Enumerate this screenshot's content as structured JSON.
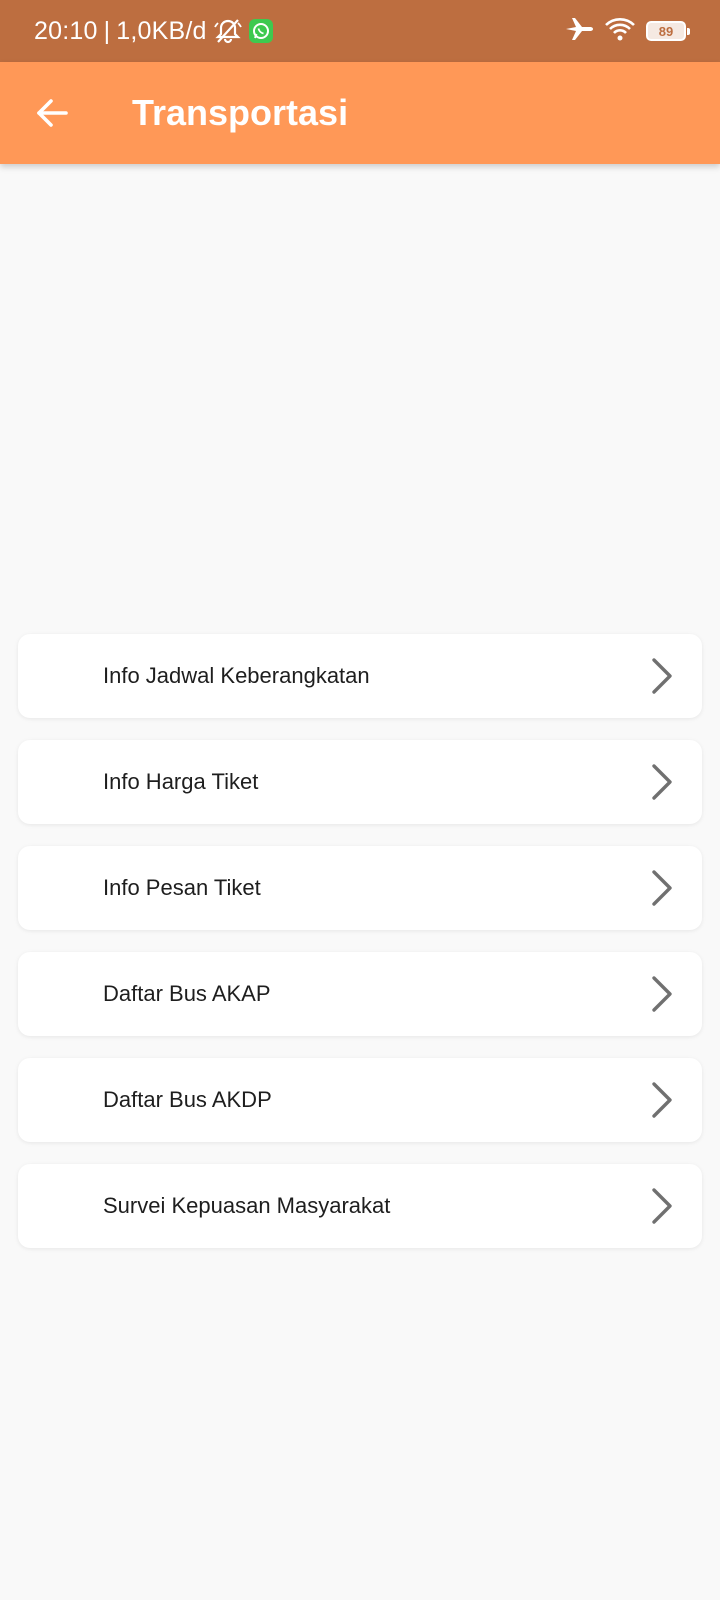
{
  "status_bar": {
    "time": "20:10",
    "separator": "|",
    "net_speed": "1,0KB/d",
    "battery": "89",
    "icons": [
      "bell-off-icon",
      "whatsapp-icon",
      "airplane-icon",
      "wifi-icon",
      "battery-icon"
    ],
    "bg_color": "#bd6e40"
  },
  "app_bar": {
    "title": "Transportasi",
    "back_icon": "arrow-left-icon",
    "bg_color": "#ff9857"
  },
  "menu": {
    "items": [
      {
        "label": "Info Jadwal Keberangkatan"
      },
      {
        "label": "Info Harga Tiket"
      },
      {
        "label": "Info Pesan Tiket"
      },
      {
        "label": "Daftar Bus AKAP"
      },
      {
        "label": "Daftar Bus AKDP"
      },
      {
        "label": "Survei Kepuasan Masyarakat"
      }
    ],
    "chevron_icon": "chevron-right-icon"
  }
}
